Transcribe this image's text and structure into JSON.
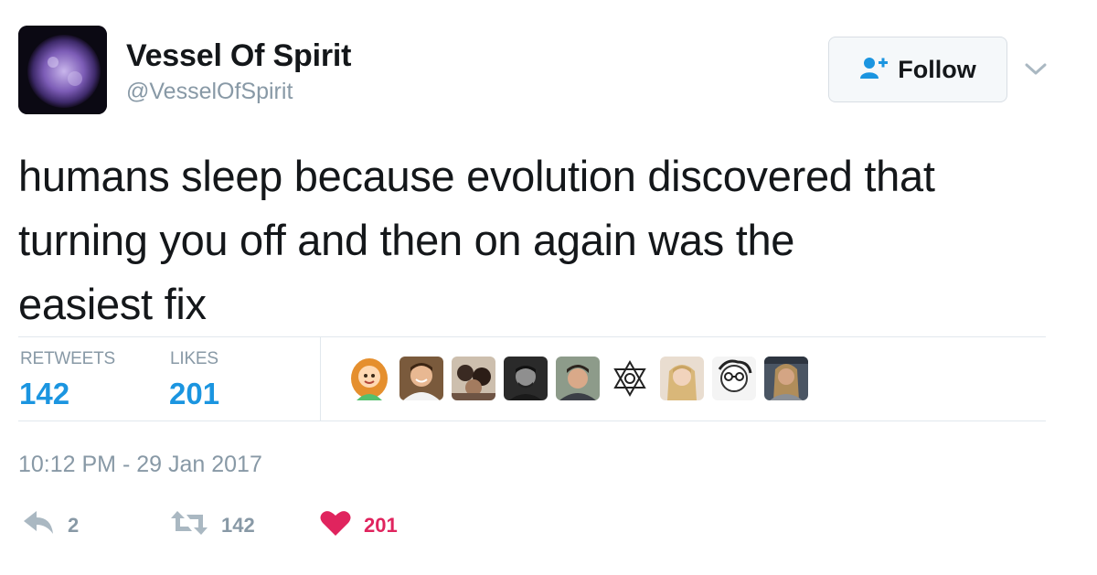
{
  "user": {
    "name": "Vessel Of Spirit",
    "handle": "@VesselOfSpirit"
  },
  "follow_button": {
    "label": "Follow"
  },
  "tweet": {
    "lines": [
      "humans sleep because evolution discovered that",
      "turning you off and then on again was the",
      "easiest fix"
    ],
    "timestamp": "10:12 PM - 29 Jan 2017"
  },
  "stats": {
    "retweets_label": "RETWEETS",
    "retweets_value": "142",
    "likes_label": "LIKES",
    "likes_value": "201"
  },
  "actions": {
    "reply_count": "2",
    "retweet_count": "142",
    "like_count": "201"
  },
  "colors": {
    "link_blue": "#1b95e0",
    "like_red": "#e0245e",
    "muted_gray": "#8899a6"
  },
  "likers": [
    {
      "icon": "avatar-cartoon-redhead"
    },
    {
      "icon": "avatar-photo-man"
    },
    {
      "icon": "avatar-photo-group"
    },
    {
      "icon": "avatar-photo-man-dark"
    },
    {
      "icon": "avatar-photo-man-hat"
    },
    {
      "icon": "avatar-hexagram-symbol"
    },
    {
      "icon": "avatar-photo-blonde-woman"
    },
    {
      "icon": "avatar-sketch-glasses"
    },
    {
      "icon": "avatar-photo-thor"
    }
  ]
}
